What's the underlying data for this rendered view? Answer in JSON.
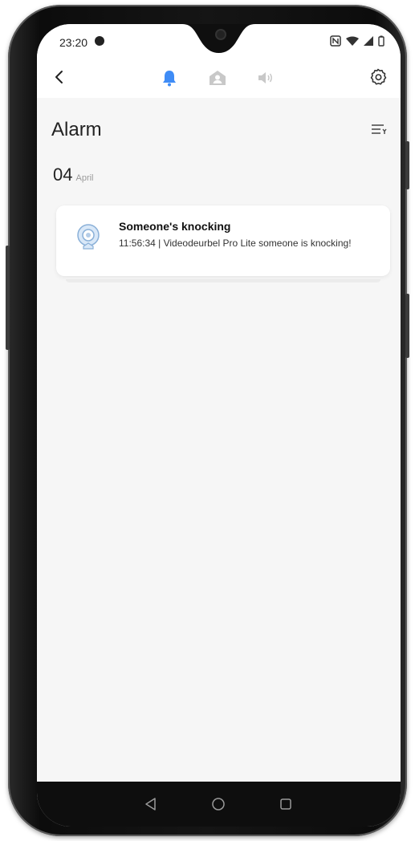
{
  "status_bar": {
    "time": "23:20"
  },
  "header": {
    "tabs": [
      {
        "icon": "bell-icon",
        "active": true
      },
      {
        "icon": "person-home-icon",
        "active": false
      },
      {
        "icon": "speaker-icon",
        "active": false
      }
    ]
  },
  "main": {
    "title": "Alarm",
    "date": {
      "day": "04",
      "month": "April"
    },
    "alarms": [
      {
        "title": "Someone's knocking",
        "description": "11:56:34 | Videodeurbel Pro Lite someone is knocking!",
        "icon": "camera-device-icon"
      }
    ]
  },
  "colors": {
    "accent": "#3f8cf6",
    "inactive": "#c8c8c8"
  }
}
